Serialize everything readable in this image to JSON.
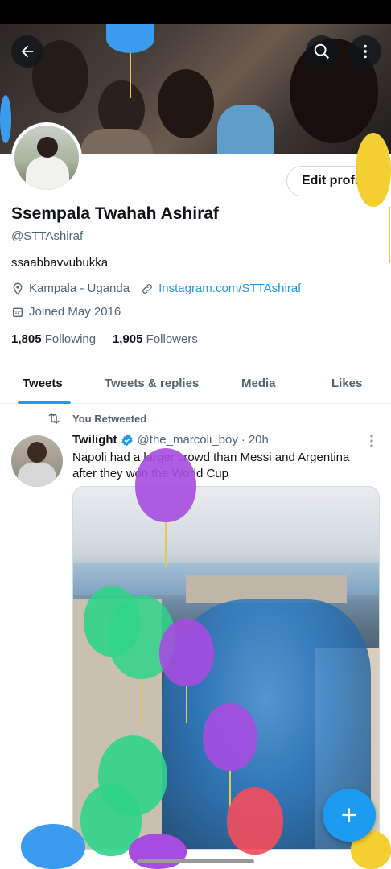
{
  "profile": {
    "name": "Ssempala Twahah Ashiraf",
    "handle": "@STTAshiraf",
    "bio": "ssaabbavvubukka",
    "location": "Kampala - Uganda",
    "website": "Instagram.com/STTAshiraf",
    "joined": "Joined May 2016",
    "following_count": "1,805",
    "following_label": "Following",
    "followers_count": "1,905",
    "followers_label": "Followers",
    "edit_button": "Edit profile"
  },
  "tabs": [
    {
      "label": "Tweets"
    },
    {
      "label": "Tweets & replies"
    },
    {
      "label": "Media"
    },
    {
      "label": "Likes"
    }
  ],
  "tweet": {
    "retweet_context": "You Retweeted",
    "author": "Twilight",
    "author_handle": "@the_marcoli_boy",
    "separator": "·",
    "time": "20h",
    "text": "Napoli had a larger crowd than Messi and Argentina after they won the World Cup"
  },
  "icons": [
    "back-arrow-icon",
    "search-icon",
    "more-vertical-icon",
    "location-pin-icon",
    "link-icon",
    "calendar-icon",
    "retweet-icon",
    "verified-badge-icon",
    "compose-plus-icon"
  ],
  "colors": {
    "accent": "#1d9bf0",
    "text": "#0f1419",
    "muted": "#536471"
  }
}
